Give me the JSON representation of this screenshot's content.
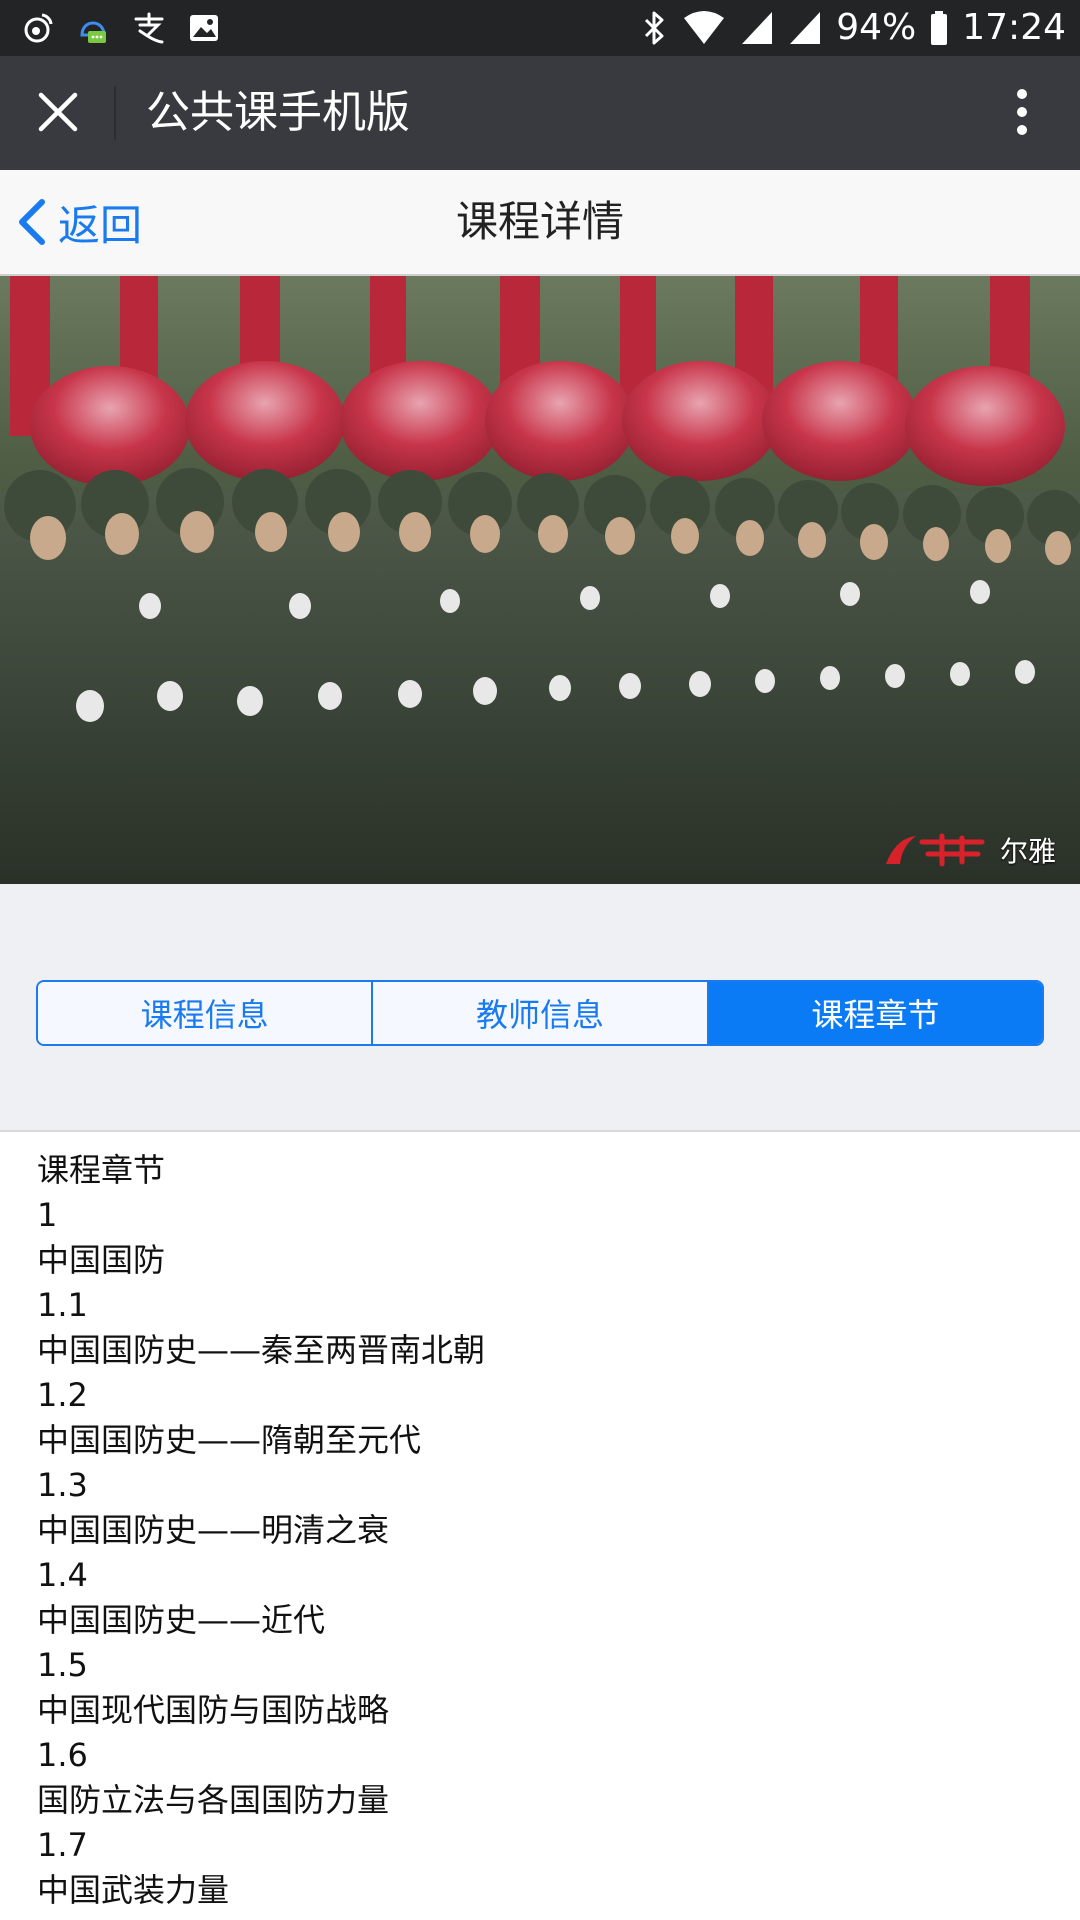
{
  "status_bar": {
    "battery": "94%",
    "time": "17:24",
    "left_icons": [
      "weibo-icon",
      "qq-notify-icon",
      "alipay-icon",
      "gallery-icon"
    ],
    "right_icons": [
      "bluetooth-icon",
      "wifi-icon",
      "signal-icon",
      "signal-icon",
      "battery-icon"
    ]
  },
  "appbar": {
    "title": "公共课手机版"
  },
  "navbar": {
    "back_label": "返回",
    "title": "课程详情"
  },
  "video": {
    "watermark_text": "尔雅"
  },
  "tabs": {
    "items": [
      "课程信息",
      "教师信息",
      "课程章节"
    ],
    "active_index": 2
  },
  "content": {
    "lines": [
      "课程章节",
      "1",
      "中国国防",
      "1.1",
      "中国国防史——秦至两晋南北朝",
      "1.2",
      "中国国防史——隋朝至元代",
      "1.3",
      "中国国防史——明清之衰",
      "1.4",
      "中国国防史——近代",
      "1.5",
      "中国现代国防与国防战略",
      "1.6",
      "国防立法与各国国防力量",
      "1.7",
      "中国武装力量"
    ]
  },
  "colors": {
    "accent": "#0a7bf5",
    "appbar": "#393a3f",
    "statusbar": "#222426",
    "tabs_bg": "#eff0f4"
  }
}
